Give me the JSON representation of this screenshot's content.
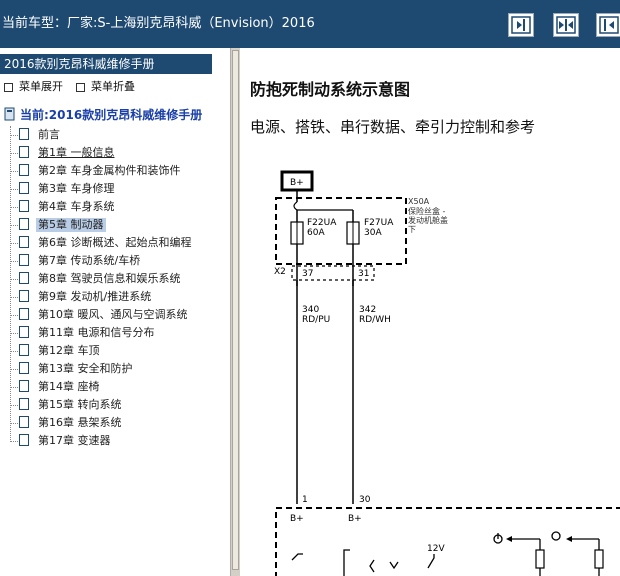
{
  "window": {
    "title": "当前车型：厂家:S-上海别克昂科威（Envision）2016"
  },
  "toolbar": {
    "buttons": [
      {
        "name": "collapse-pane-button",
        "icon": "collapse-left-icon"
      },
      {
        "name": "split-pane-button",
        "icon": "split-pane-icon"
      },
      {
        "name": "expand-pane-button",
        "icon": "expand-right-icon"
      }
    ]
  },
  "sidebar": {
    "book_title": "2016款别克昂科威维修手册",
    "expand_all": "菜单展开",
    "collapse_all": "菜单折叠",
    "current": "当前:2016款别克昂科威维修手册",
    "items": [
      {
        "label": "前言"
      },
      {
        "label": "第1章 一般信息"
      },
      {
        "label": "第2章 车身金属构件和装饰件"
      },
      {
        "label": "第3章 车身修理"
      },
      {
        "label": "第4章 车身系统"
      },
      {
        "label": "第5章 制动器"
      },
      {
        "label": "第6章 诊断概述、起始点和编程"
      },
      {
        "label": "第7章 传动系统/车桥"
      },
      {
        "label": "第8章 驾驶员信息和娱乐系统"
      },
      {
        "label": "第9章 发动机/推进系统"
      },
      {
        "label": "第10章 暖风、通风与空调系统"
      },
      {
        "label": "第11章 电源和信号分布"
      },
      {
        "label": "第12章 车顶"
      },
      {
        "label": "第13章 安全和防护"
      },
      {
        "label": "第14章 座椅"
      },
      {
        "label": "第15章 转向系统"
      },
      {
        "label": "第16章 悬架系统"
      },
      {
        "label": "第17章 变速器"
      }
    ],
    "selected_index": 5
  },
  "content": {
    "heading": "防抱死制动系统示意图",
    "subheading": "电源、搭铁、串行数据、牵引力控制和参考"
  },
  "diagram": {
    "bplus_top": "B+",
    "fusebox_label_1": "X50A",
    "fusebox_label_2": "保险丝盒 -",
    "fusebox_label_3": "发动机舱盖",
    "fusebox_label_4": "下",
    "fuse1_name": "F22UA",
    "fuse1_rating": "60A",
    "fuse2_name": "F27UA",
    "fuse2_rating": "30A",
    "connector": "X2",
    "pin1": "37",
    "pin2": "31",
    "wire1_num": "340",
    "wire1_color": "RD/PU",
    "wire2_num": "342",
    "wire2_color": "RD/WH",
    "term1": "1",
    "term2": "30",
    "bplus_1": "B+",
    "bplus_2": "B+",
    "voltage": "12V"
  },
  "colors": {
    "title_bar": "#1e4a72",
    "selection": "#b9cde6",
    "current_link": "#1a3fa8"
  }
}
